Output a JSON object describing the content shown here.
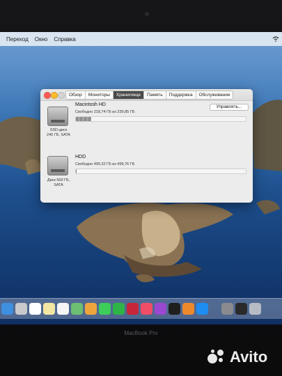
{
  "menubar": {
    "items": [
      "Переход",
      "Окно",
      "Справка"
    ]
  },
  "window": {
    "tabs": [
      {
        "label": "Обзор",
        "active": false
      },
      {
        "label": "Мониторы",
        "active": false
      },
      {
        "label": "Хранилище",
        "active": true
      },
      {
        "label": "Память",
        "active": false
      },
      {
        "label": "Поддержка",
        "active": false
      },
      {
        "label": "Обслуживание",
        "active": false
      }
    ],
    "disk1": {
      "name": "Macintosh HD",
      "free": "Свободно 218,74 ГБ из 239,85 ГБ",
      "caption_line1": "SSD-диск",
      "caption_line2": "240 ГБ, SATA",
      "used_fraction": 0.09,
      "manage_label": "Управлять..."
    },
    "disk2": {
      "name": "HDD",
      "free": "Свободно 499,32 ГБ из 499,76 ГБ",
      "caption_line1": "Диск 500 ГБ,",
      "caption_line2": "SATA",
      "used_fraction": 0.001
    }
  },
  "dock": {
    "icons": [
      "finder-icon",
      "launchpad-icon",
      "calendar-icon",
      "notes-icon",
      "reminders-icon",
      "maps-icon",
      "photos-icon",
      "messages-icon",
      "facetime-icon",
      "photobooth-icon",
      "music-icon",
      "podcasts-icon",
      "tv-icon",
      "books-icon",
      "appstore-icon",
      "systemprefs-icon",
      "terminal-icon",
      "trash-icon"
    ],
    "colors": [
      "#3f8fe0",
      "#c9c9cc",
      "#ffffff",
      "#f3e6a3",
      "#f5f5f5",
      "#6dbf72",
      "#f0a53c",
      "#3ccd5a",
      "#2fb447",
      "#c8253a",
      "#f04d68",
      "#9a48d0",
      "#1f1f1f",
      "#ec8a2b",
      "#1d8df2",
      "#8b8b8f",
      "#2a2a2a",
      "#b7bcc4"
    ]
  },
  "brand": {
    "text": "MacBook Pro"
  },
  "watermark": {
    "text": "Avito"
  }
}
